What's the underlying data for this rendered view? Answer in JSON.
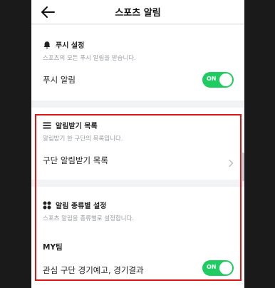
{
  "header": {
    "title": "스포츠 알림"
  },
  "push": {
    "section_title": "푸시 설정",
    "description": "스포츠의 모든 푸시 알림을 받습니다.",
    "row_label": "푸시 알림",
    "toggle_state": "ON"
  },
  "subscriptions": {
    "section_title": "알림받기 목록",
    "description": "알림받기 한 구단의 목록입니다.",
    "row_label": "구단 알림받기 목록"
  },
  "by_type": {
    "section_title": "알림 종류별 설정",
    "description": "스포츠 알림을 종류별로 설정합니다.",
    "group_title": "MY팀",
    "row_label": "관심 구단 경기예고, 경기결과",
    "toggle_state": "ON"
  },
  "colors": {
    "toggle_on": "#1fcc62",
    "highlight_border": "#e01515"
  }
}
